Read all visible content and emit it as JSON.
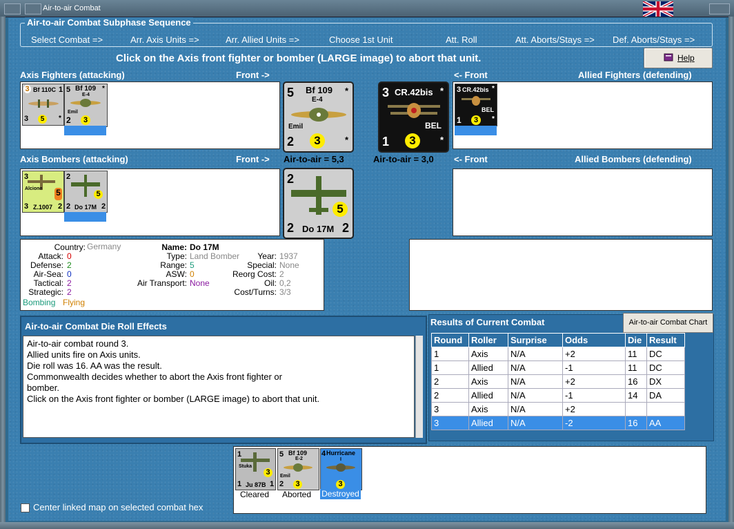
{
  "window": {
    "title": "Air-to-air Combat"
  },
  "phase": {
    "title": "Air-to-air Combat Subphase Sequence",
    "steps": [
      "Select Combat =>",
      "Arr. Axis Units =>",
      "Arr. Allied Units =>",
      "Choose 1st Unit",
      "Att. Roll",
      "Att. Aborts/Stays =>",
      "Def. Aborts/Stays =>"
    ]
  },
  "instruction": "Click on the Axis front fighter or bomber  (LARGE image) to abort that unit.",
  "help_label": "Help",
  "sections": {
    "axis_fighters": "Axis Fighters (attacking)",
    "front_right": "Front ->",
    "front_left": "<- Front",
    "allied_fighters": "Allied Fighters (defending)",
    "axis_bombers": "Axis Bombers (attacking)",
    "allied_bombers": "Allied Bombers (defending)"
  },
  "axis_fighters": [
    {
      "name": "Bf 110C",
      "attack": "3",
      "defense": "1",
      "tl": "3",
      "circle": "5",
      "star": "*"
    },
    {
      "name": "Bf 109",
      "sub": "E-4",
      "nick": "Emil",
      "attack": "5",
      "tl": "2",
      "circle": "3",
      "star": "*"
    }
  ],
  "axis_front_fighter": {
    "name": "Bf 109",
    "sub": "E-4",
    "nick": "Emil",
    "top": "5",
    "bot": "2",
    "circle": "3",
    "star": "*"
  },
  "axis_front_fighter_a2a": "Air-to-air = 5,3",
  "allied_front_fighter": {
    "name": "CR.42bis",
    "top": "3",
    "bot": "1",
    "circle": "3",
    "nat": "BEL",
    "star": "*"
  },
  "allied_front_fighter_a2a": "Air-to-air = 3,0",
  "allied_fighters": [
    {
      "name": "CR.42bis",
      "nat": "BEL",
      "top": "3",
      "bot": "1",
      "circle": "3",
      "star": "*"
    }
  ],
  "axis_bombers": [
    {
      "name": "Z.1007",
      "nick": "Alcione",
      "top": "3",
      "bot": "3",
      "r": "2",
      "circle": "5"
    },
    {
      "name": "Do 17M",
      "top": "2",
      "bot": "2",
      "r": "2",
      "circle": "5"
    }
  ],
  "axis_front_bomber": {
    "name": "Do 17M",
    "top": "2",
    "bot": "2",
    "r": "2",
    "circle": "5"
  },
  "unit_info": {
    "country_label": "Country:",
    "country": "Germany",
    "attack_label": "Attack:",
    "attack": "0",
    "defense_label": "Defense:",
    "defense": "2",
    "airsea_label": "Air-Sea:",
    "airsea": "0",
    "tactical_label": "Tactical:",
    "tactical": "2",
    "strategic_label": "Strategic:",
    "strategic": "2",
    "bombing": "Bombing",
    "flying": "Flying",
    "name_label": "Name:",
    "name": "Do 17M",
    "type_label": "Type:",
    "type": "Land Bomber",
    "range_label": "Range:",
    "range": "5",
    "asw_label": "ASW:",
    "asw": "0",
    "airtransport_label": "Air Transport:",
    "airtransport": "None",
    "year_label": "Year:",
    "year": "1937",
    "special_label": "Special:",
    "special": "None",
    "reorg_label": "Reorg Cost:",
    "reorg": "2",
    "oil_label": "Oil:",
    "oil": "0,2",
    "costturns_label": "Cost/Turns:",
    "costturns": "3/3",
    "colors": {
      "red": "#d40000",
      "green": "#1a8a1a",
      "blue": "#1030c0",
      "orange": "#d08000",
      "purple": "#8a1aa0",
      "gray": "#888888",
      "teal": "#1a9a7a"
    }
  },
  "die_roll": {
    "title": "Air-to-air Combat Die Roll Effects",
    "lines": [
      "Air-to-air combat round 3.",
      "Allied units fire on Axis units.",
      "Die roll was 16.  AA was the result.",
      "Commonwealth decides whether to abort the Axis front fighter or",
      "bomber.",
      "Click on the Axis front fighter or bomber  (LARGE image) to abort that unit."
    ]
  },
  "results": {
    "title": "Results of Current Combat",
    "chart_button": "Air-to-air Combat Chart",
    "headers": [
      "Round",
      "Roller",
      "Surprise",
      "Odds",
      "Die",
      "Result"
    ],
    "rows": [
      [
        "1",
        "Axis",
        "N/A",
        "+2",
        "11",
        "DC"
      ],
      [
        "1",
        "Allied",
        "N/A",
        "-1",
        "11",
        "DC"
      ],
      [
        "2",
        "Axis",
        "N/A",
        "+2",
        "16",
        "DX"
      ],
      [
        "2",
        "Allied",
        "N/A",
        "-1",
        "14",
        "DA"
      ],
      [
        "3",
        "Axis",
        "N/A",
        "+2",
        "",
        ""
      ],
      [
        "3",
        "Allied",
        "N/A",
        "-2",
        "16",
        "AA"
      ]
    ],
    "selected_row": 5
  },
  "outcomes": [
    {
      "name": "Ju 87B",
      "nick": "Stuka",
      "top": "1",
      "bot": "1",
      "r": "1",
      "circle": "3",
      "caption": "Cleared"
    },
    {
      "name": "Bf 109",
      "sub": "E-2",
      "nick": "Emil",
      "top": "5",
      "bot": "2",
      "circle": "3",
      "caption": "Aborted"
    },
    {
      "name": "Hurricane",
      "sub": "I",
      "top": "4",
      "circle": "3",
      "caption": "Destroyed"
    }
  ],
  "center_map_label": "Center linked map on selected combat hex"
}
